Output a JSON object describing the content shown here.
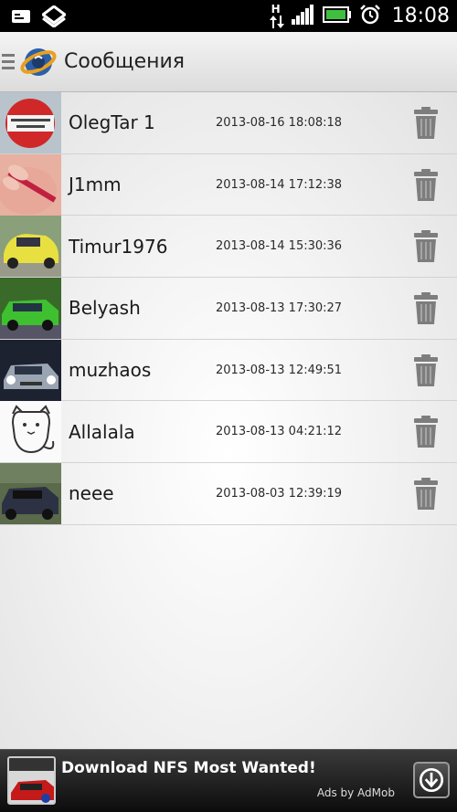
{
  "status_bar": {
    "time": "18:08",
    "network_label": "H"
  },
  "action_bar": {
    "title": "Сообщения"
  },
  "messages": [
    {
      "name": "OlegTar 1",
      "date": "2013-08-16 18:08:18"
    },
    {
      "name": "J1mm",
      "date": "2013-08-14 17:12:38"
    },
    {
      "name": "Timur1976",
      "date": "2013-08-14 15:30:36"
    },
    {
      "name": "Belyash",
      "date": "2013-08-13 17:30:27"
    },
    {
      "name": "muzhaos",
      "date": "2013-08-13 12:49:51"
    },
    {
      "name": "Allalala",
      "date": "2013-08-13 04:21:12"
    },
    {
      "name": "neee",
      "date": "2013-08-03 12:39:19"
    }
  ],
  "ad": {
    "text": "Download NFS Most Wanted!",
    "by": "Ads by AdMob"
  }
}
